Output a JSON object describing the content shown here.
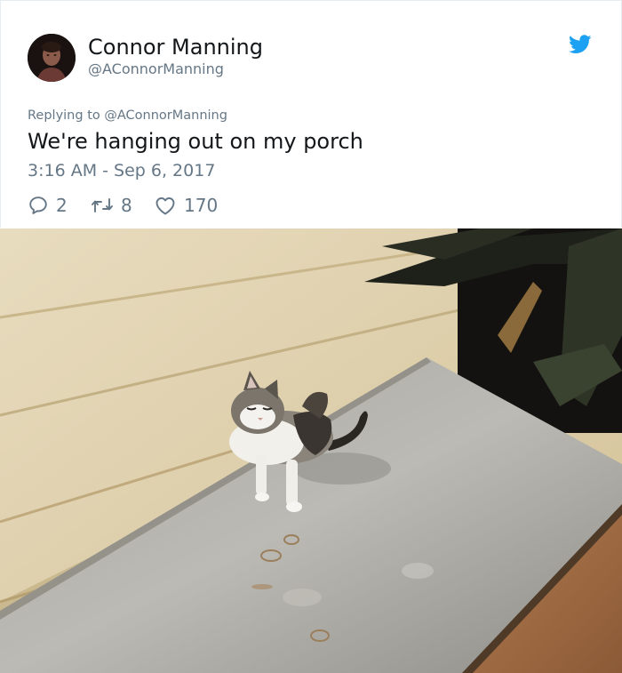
{
  "author": {
    "name": "Connor Manning",
    "handle": "@AConnorManning"
  },
  "tweet": {
    "reply_prefix": "Replying to",
    "reply_to": "@AConnorManning",
    "text": "We're hanging out on my porch",
    "timestamp": "3:16 AM - Sep 6, 2017"
  },
  "actions": {
    "reply_count": "2",
    "retweet_count": "8",
    "like_count": "170"
  },
  "icons": {
    "logo": "twitter-bird-icon",
    "reply": "speech-bubble-icon",
    "retweet": "retweet-arrows-icon",
    "like": "heart-icon"
  },
  "colors": {
    "brand": "#1da1f2",
    "text": "#14171a",
    "muted": "#657786"
  }
}
